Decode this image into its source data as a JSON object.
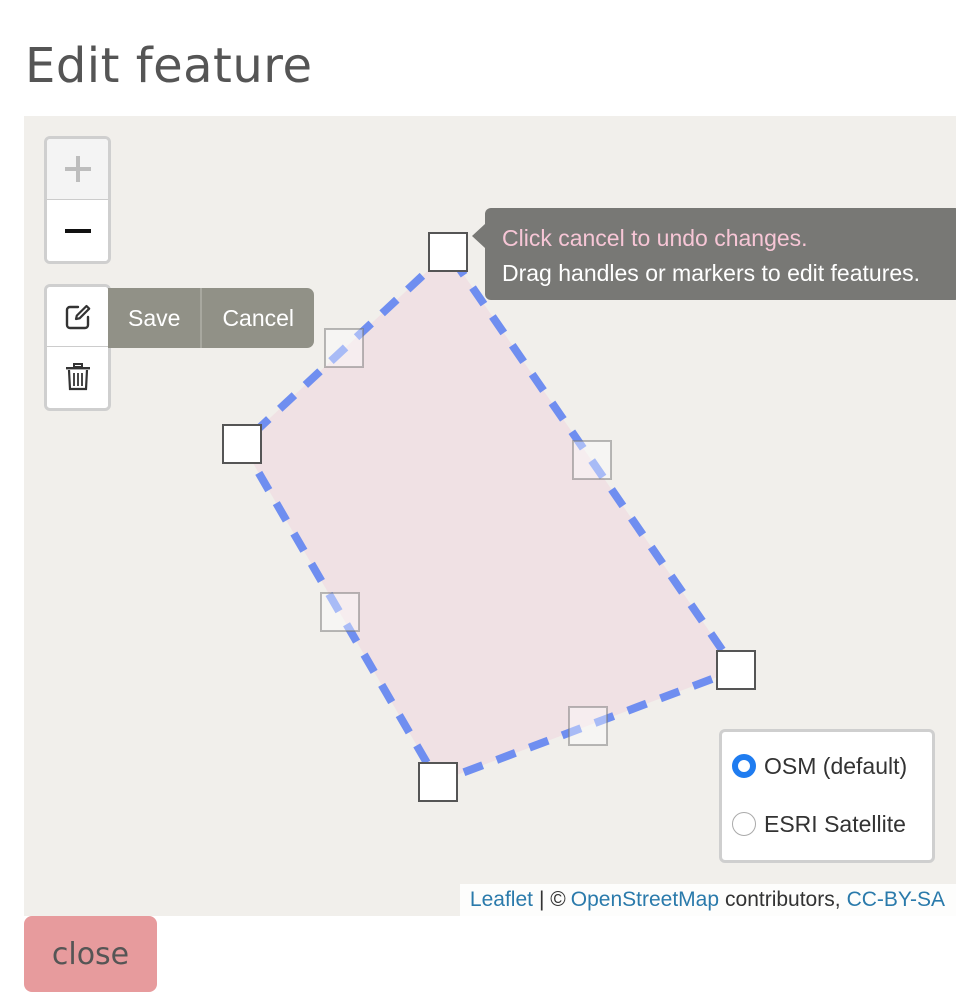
{
  "page": {
    "title": "Edit feature"
  },
  "map": {
    "zoom": {
      "in_symbol": "+",
      "out_symbol": "−"
    },
    "edit_toolbar": {
      "edit_icon": "edit-icon",
      "delete_icon": "trash-icon",
      "save_label": "Save",
      "cancel_label": "Cancel"
    },
    "tooltip": {
      "subtext": "Click cancel to undo changes.",
      "text": "Drag handles or markers to edit features."
    },
    "layers": [
      {
        "label": "OSM (default)",
        "checked": true
      },
      {
        "label": "ESRI Satellite",
        "checked": false
      }
    ],
    "attribution": {
      "leaflet": "Leaflet",
      "separator": "| ©",
      "osm": "OpenStreetMap",
      "contributors": "contributors,",
      "license": "CC-BY-SA"
    },
    "polygon": {
      "stroke_color": "#6f8ef0",
      "fill_color": "#f0d8e0"
    }
  },
  "footer": {
    "close_label": "close"
  }
}
